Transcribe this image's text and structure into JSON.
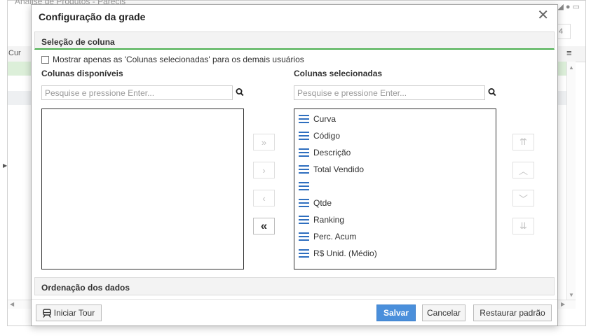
{
  "background": {
    "title": "Analise de Produtos - Parecis",
    "box_value": "4",
    "header_cell": "Cur"
  },
  "dialog": {
    "title": "Configuração da grade",
    "close_glyph": "✕",
    "section_column_selection": "Seleção de coluna",
    "show_selected_checkbox_label": "Mostrar apenas as 'Colunas selecionadas' para os demais usuários",
    "available": {
      "title": "Colunas disponíveis",
      "search_placeholder": "Pesquise e pressione Enter...",
      "items": []
    },
    "selected": {
      "title": "Colunas selecionadas",
      "search_placeholder": "Pesquise e pressione Enter...",
      "items": [
        {
          "label": "Curva"
        },
        {
          "label": "Código"
        },
        {
          "label": "Descrição"
        },
        {
          "label": "Total Vendido"
        },
        {
          "label": ""
        },
        {
          "label": "Qtde"
        },
        {
          "label": "Ranking"
        },
        {
          "label": "Perc. Acum"
        },
        {
          "label": "R$ Unid. (Médio)"
        }
      ]
    },
    "transfer_buttons": {
      "move_all_right": "»",
      "move_right": "›",
      "move_left": "‹",
      "move_all_left": "«"
    },
    "order_buttons": {
      "move_top": "⇈",
      "move_up": "︿",
      "move_down": "﹀",
      "move_bottom": "⇊"
    },
    "section_sort": "Ordenação dos dados",
    "footer": {
      "tour_label": "Iniciar Tour",
      "save_label": "Salvar",
      "cancel_label": "Cancelar",
      "restore_label": "Restaurar padrão"
    }
  },
  "colors": {
    "accent_green": "#4caf50",
    "primary_button": "#4a8fdb",
    "drag_icon": "#2f6fbf",
    "selected_row_bg": "#dcefd9"
  }
}
